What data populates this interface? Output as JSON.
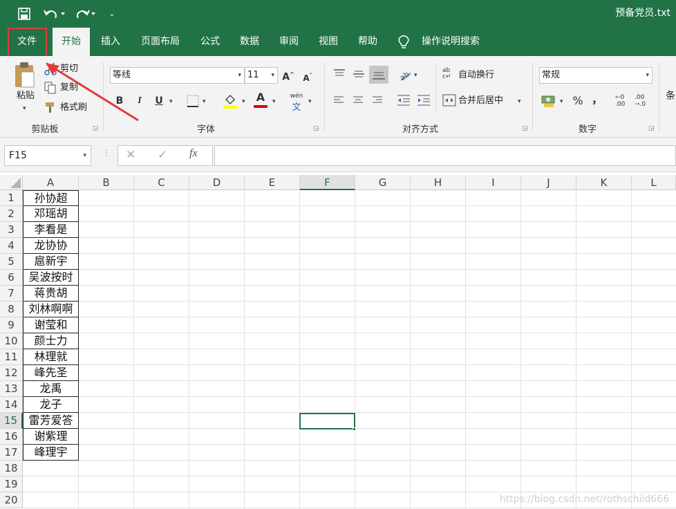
{
  "titlebar": {
    "save_icon": "save-icon",
    "undo_icon": "undo-icon",
    "redo_icon": "redo-icon",
    "doc_title": "预备党员.txt"
  },
  "tabs": [
    "文件",
    "开始",
    "插入",
    "页面布局",
    "公式",
    "数据",
    "审阅",
    "视图",
    "帮助"
  ],
  "tell_me": "操作说明搜索",
  "ribbon": {
    "clipboard": {
      "paste": "粘贴",
      "cut": "剪切",
      "copy": "复制",
      "format_painter": "格式刷",
      "label": "剪贴板"
    },
    "font": {
      "name": "等线",
      "size": "11",
      "grow": "A",
      "shrink": "A",
      "bold": "B",
      "italic": "I",
      "underline": "U",
      "label": "字体",
      "phonetic": "wén"
    },
    "alignment": {
      "wrap": "自动换行",
      "merge": "合并后居中",
      "label": "对齐方式"
    },
    "number": {
      "format": "常规",
      "percent": "%",
      "comma": "，",
      "inc_decimal": ".00",
      "dec_decimal": ".0",
      "label": "数字"
    },
    "next_group": "条"
  },
  "formula_bar": {
    "name_box": "F15",
    "cancel": "✕",
    "enter": "✓",
    "fx": "fx",
    "value": ""
  },
  "columns": [
    "A",
    "B",
    "C",
    "D",
    "E",
    "F",
    "G",
    "H",
    "I",
    "J",
    "K",
    "L"
  ],
  "selected_column": "F",
  "rows": [
    "1",
    "2",
    "3",
    "4",
    "5",
    "6",
    "7",
    "8",
    "9",
    "10",
    "11",
    "12",
    "13",
    "14",
    "15",
    "16",
    "17",
    "18",
    "19",
    "20"
  ],
  "selected_row": "15",
  "column_a": [
    "孙协超",
    "邓瑶胡",
    "李看是",
    "龙协协",
    "扈新宇",
    "吴波按时",
    "蒋贵胡",
    "刘林啊啊",
    "谢莹和",
    "颜士力",
    "林理就",
    "峰先圣",
    "龙禹",
    "龙子",
    "雷芳爱答",
    "谢紫理",
    "峰理宇"
  ],
  "watermark": "https://blog.csdn.net/rothschild666",
  "colors": {
    "accent": "#217346",
    "highlight_box": "#e23b3b"
  }
}
